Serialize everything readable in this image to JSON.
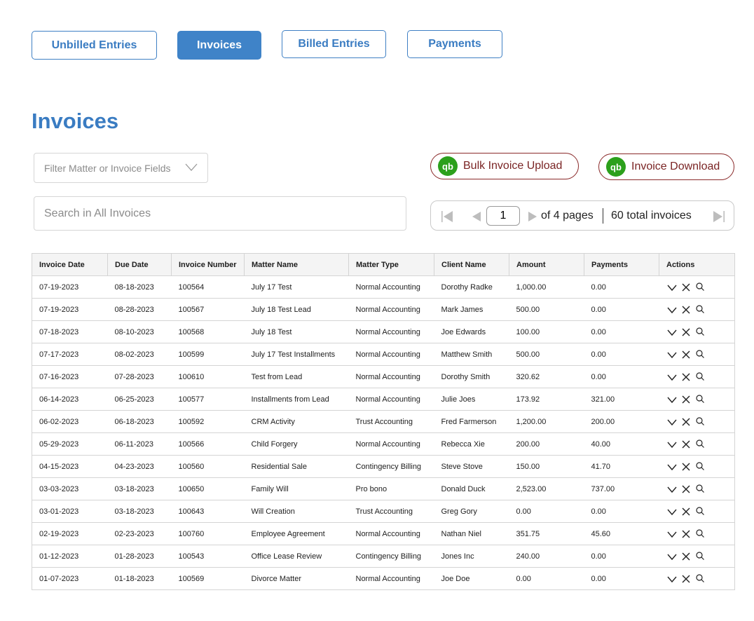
{
  "tabs": {
    "unbilled": "Unbilled Entries",
    "invoices": "Invoices",
    "billed": "Billed Entries",
    "payments": "Payments"
  },
  "page_title": "Invoices",
  "filter": {
    "placeholder": "Filter Matter or Invoice Fields"
  },
  "search": {
    "placeholder": "Search in All Invoices"
  },
  "buttons": {
    "bulk_upload": "Bulk Invoice Upload",
    "invoice_download": "Invoice Download",
    "qb_logo": "qb"
  },
  "pager": {
    "current_page": "1",
    "of_pages": "of 4 pages",
    "total": "60 total invoices"
  },
  "colors": {
    "accent": "#3f83c8",
    "qb_green": "#2ca01c",
    "qb_border": "#8a2a2a"
  },
  "table": {
    "columns": [
      "Invoice Date",
      "Due Date",
      "Invoice Number",
      "Matter Name",
      "Matter Type",
      "Client Name",
      "Amount",
      "Payments",
      "Actions"
    ],
    "rows": [
      [
        "07-19-2023",
        "08-18-2023",
        "100564",
        "July 17 Test",
        "Normal Accounting",
        "Dorothy Radke",
        "1,000.00",
        "0.00"
      ],
      [
        "07-19-2023",
        "08-28-2023",
        "100567",
        "July 18 Test Lead",
        "Normal Accounting",
        "Mark James",
        "500.00",
        "0.00"
      ],
      [
        "07-18-2023",
        "08-10-2023",
        "100568",
        "July 18 Test",
        "Normal Accounting",
        "Joe Edwards",
        "100.00",
        "0.00"
      ],
      [
        "07-17-2023",
        "08-02-2023",
        "100599",
        "July 17 Test Installments",
        "Normal Accounting",
        "Matthew Smith",
        "500.00",
        "0.00"
      ],
      [
        "07-16-2023",
        "07-28-2023",
        "100610",
        "Test from Lead",
        "Normal Accounting",
        "Dorothy Smith",
        "320.62",
        "0.00"
      ],
      [
        "06-14-2023",
        "06-25-2023",
        "100577",
        "Installments from Lead",
        "Normal Accounting",
        "Julie Joes",
        "173.92",
        "321.00"
      ],
      [
        "06-02-2023",
        "06-18-2023",
        "100592",
        "CRM Activity",
        "Trust Accounting",
        "Fred Farmerson",
        "1,200.00",
        "200.00"
      ],
      [
        "05-29-2023",
        "06-11-2023",
        "100566",
        "Child Forgery",
        "Normal Accounting",
        "Rebecca Xie",
        "200.00",
        "40.00"
      ],
      [
        "04-15-2023",
        "04-23-2023",
        "100560",
        "Residential Sale",
        "Contingency Billing",
        "Steve Stove",
        "150.00",
        "41.70"
      ],
      [
        "03-03-2023",
        "03-18-2023",
        "100650",
        "Family Will",
        "Pro bono",
        "Donald Duck",
        "2,523.00",
        "737.00"
      ],
      [
        "03-01-2023",
        "03-18-2023",
        "100643",
        "Will Creation",
        "Trust Accounting",
        "Greg Gory",
        "0.00",
        "0.00"
      ],
      [
        "02-19-2023",
        "02-23-2023",
        "100760",
        "Employee Agreement",
        "Normal Accounting",
        "Nathan Niel",
        "351.75",
        "45.60"
      ],
      [
        "01-12-2023",
        "01-28-2023",
        "100543",
        "Office Lease Review",
        "Contingency Billing",
        "Jones Inc",
        "240.00",
        "0.00"
      ],
      [
        "01-07-2023",
        "01-18-2023",
        "100569",
        "Divorce Matter",
        "Normal Accounting",
        "Joe Doe",
        "0.00",
        "0.00"
      ]
    ],
    "row_actions": [
      "chevron-down-icon",
      "close-icon",
      "search-icon"
    ]
  }
}
